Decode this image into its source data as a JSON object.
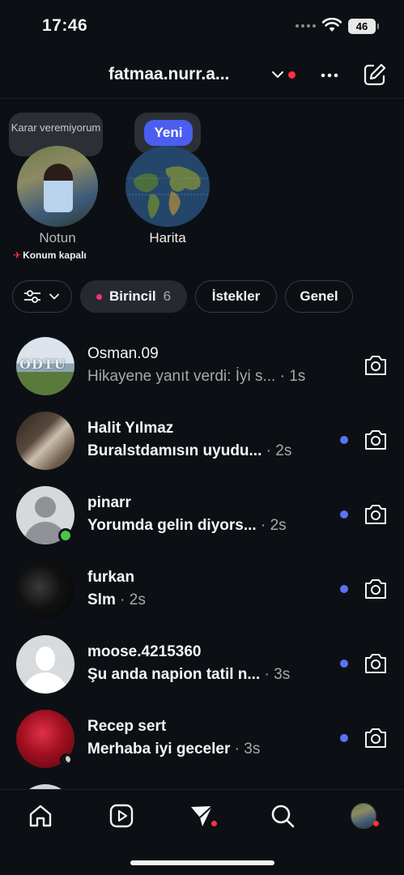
{
  "status_bar": {
    "time": "17:46",
    "battery": "46"
  },
  "header": {
    "username": "fatmaa.nurr.a..."
  },
  "notes": {
    "own_note": {
      "bubble_text": "Karar veremiyorum",
      "name": "Notun",
      "location_status": "Konum kapalı"
    },
    "map": {
      "badge": "Yeni",
      "name": "Harita"
    }
  },
  "filters": {
    "primary_label": "Birincil",
    "primary_count": "6",
    "requests_label": "İstekler",
    "general_label": "Genel"
  },
  "messages": [
    {
      "name": "Osman.09",
      "text": "Hikayene yanıt verdi: İyi s...",
      "time": "· 1s",
      "unread": false
    },
    {
      "name": "Halit Yılmaz",
      "text": "Buralstdamısın uyudu...",
      "time": "· 2s",
      "unread": true
    },
    {
      "name": "pinarr",
      "text": "Yorumda gelin diyors...",
      "time": "· 2s",
      "unread": true
    },
    {
      "name": "furkan",
      "text": "Slm",
      "time": "· 2s",
      "unread": true
    },
    {
      "name": "moose.4215360",
      "text": "Şu anda napion tatil n...",
      "time": "· 3s",
      "unread": true
    },
    {
      "name": "Recep sert",
      "text": "Merhaba iyi geceler",
      "time": "· 3s",
      "unread": true
    }
  ],
  "avatar_text": {
    "osman": "ODTU"
  },
  "colors": {
    "background": "#0c1014",
    "unread_dot": "#5b72f5",
    "notification_dot": "#ff3040",
    "online": "#4cc44c",
    "map_badge": "#4a5ff0"
  },
  "icons": [
    "wifi-icon",
    "chevron-down-icon",
    "more-icon",
    "compose-icon",
    "filter-icon",
    "camera-icon",
    "home-icon",
    "reels-icon",
    "direct-icon",
    "search-icon"
  ]
}
